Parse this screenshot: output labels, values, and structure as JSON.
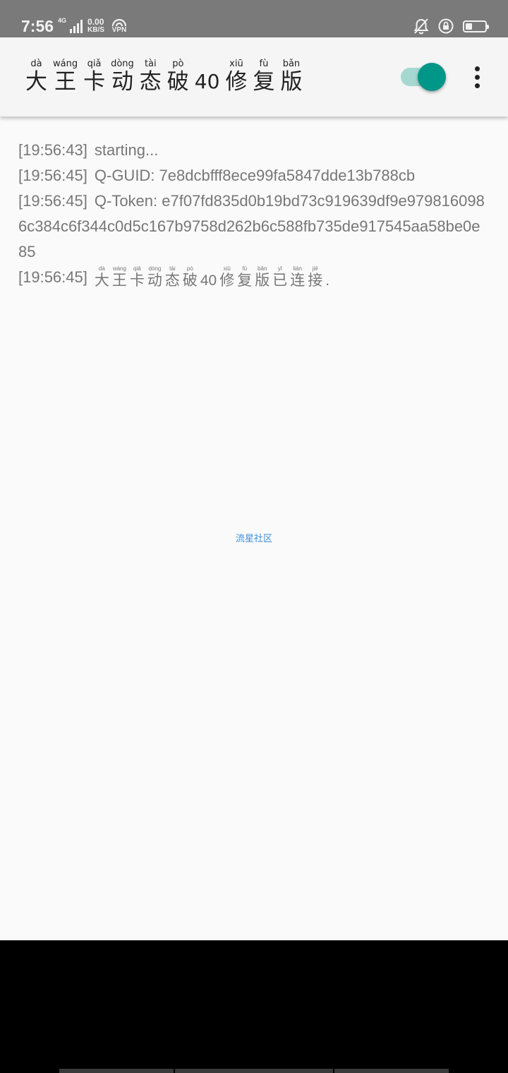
{
  "status_bar": {
    "time": "7:56",
    "network_type": "4G",
    "net_speed_value": "0.00",
    "net_speed_unit": "KB/S",
    "vpn_label": "VPN",
    "icons": [
      "signal-icon",
      "vpn-icon",
      "bell-off-icon",
      "rotation-lock-icon",
      "battery-icon"
    ],
    "battery_level": 0.35
  },
  "app_bar": {
    "title_chars": [
      {
        "pinyin": "dà",
        "hanzi": "大"
      },
      {
        "pinyin": "wáng",
        "hanzi": "王"
      },
      {
        "pinyin": "qiǎ",
        "hanzi": "卡"
      },
      {
        "pinyin": "dòng",
        "hanzi": "动"
      },
      {
        "pinyin": "tài",
        "hanzi": "态"
      },
      {
        "pinyin": "pò",
        "hanzi": "破"
      }
    ],
    "title_number": "40",
    "title_chars_tail": [
      {
        "pinyin": "xiū",
        "hanzi": "修"
      },
      {
        "pinyin": "fù",
        "hanzi": "复"
      },
      {
        "pinyin": "bǎn",
        "hanzi": "版"
      }
    ],
    "toggle_on": true,
    "accent_color": "#009688",
    "menu_icon": "more-vert-icon"
  },
  "log": {
    "lines": [
      {
        "timestamp": "[19:56:43]",
        "text": "starting..."
      },
      {
        "timestamp": "[19:56:45]",
        "text": "Q-GUID:  7e8dcbfff8ece99fa5847dde13b788cb"
      },
      {
        "timestamp": "[19:56:45]",
        "text": "Q-Token: e7f07fd835d0b19bd73c919639df9e9798160986c384c6f344c0d5c167b9758d262b6c588fb735de917545aa58be0e85"
      }
    ],
    "last_line": {
      "timestamp": "[19:56:45]",
      "chars": [
        {
          "pinyin": "dà",
          "hanzi": "大"
        },
        {
          "pinyin": "wáng",
          "hanzi": "王"
        },
        {
          "pinyin": "qiǎ",
          "hanzi": "卡"
        },
        {
          "pinyin": "dòng",
          "hanzi": "动"
        },
        {
          "pinyin": "tài",
          "hanzi": "态"
        },
        {
          "pinyin": "pò",
          "hanzi": "破"
        }
      ],
      "number": "40",
      "chars_tail": [
        {
          "pinyin": "xiū",
          "hanzi": "修"
        },
        {
          "pinyin": "fù",
          "hanzi": "复"
        },
        {
          "pinyin": "bǎn",
          "hanzi": "版"
        },
        {
          "pinyin": "yǐ",
          "hanzi": "已"
        },
        {
          "pinyin": "lián",
          "hanzi": "连"
        },
        {
          "pinyin": "jiē",
          "hanzi": "接"
        }
      ],
      "end": "."
    }
  },
  "watermark": "流星社区"
}
